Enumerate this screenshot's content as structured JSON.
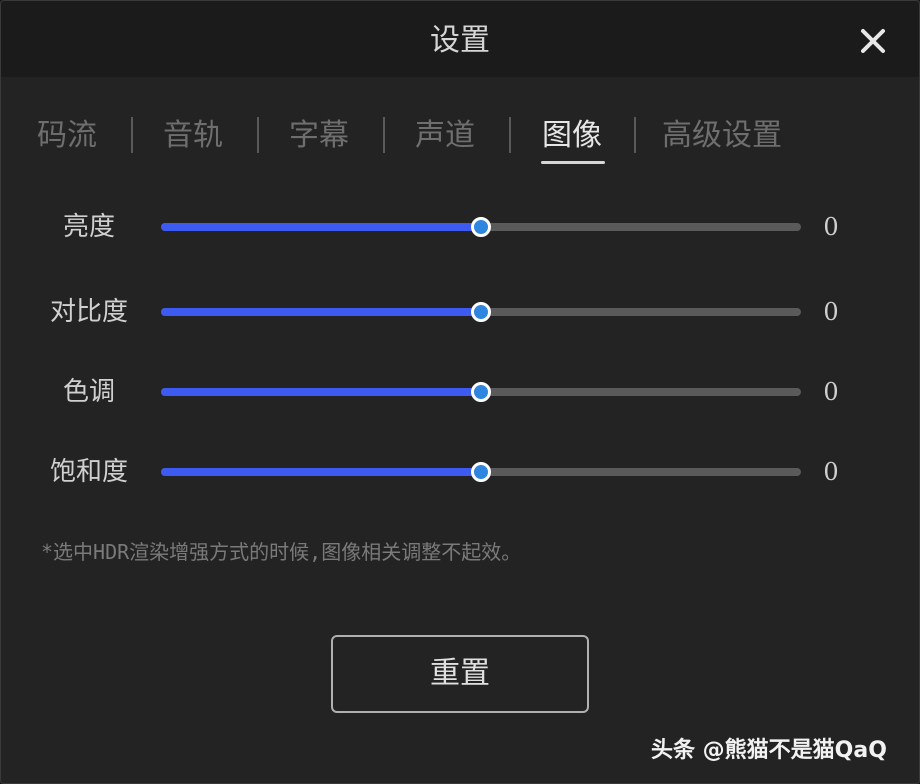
{
  "dialog": {
    "title": "设置",
    "close_icon": "close-icon"
  },
  "tabs": [
    {
      "label": "码流",
      "active": false
    },
    {
      "label": "音轨",
      "active": false
    },
    {
      "label": "字幕",
      "active": false
    },
    {
      "label": "声道",
      "active": false
    },
    {
      "label": "图像",
      "active": true
    },
    {
      "label": "高级设置",
      "active": false
    }
  ],
  "sliders": [
    {
      "label": "亮度",
      "value": "0",
      "level": 0.5
    },
    {
      "label": "对比度",
      "value": "0",
      "level": 0.5
    },
    {
      "label": "色调",
      "value": "0",
      "level": 0.5
    },
    {
      "label": "饱和度",
      "value": "0",
      "level": 0.5
    }
  ],
  "note": "*选中HDR渲染增强方式的时候,图像相关调整不起效。",
  "reset_label": "重置",
  "watermark": "头条 @熊猫不是猫QaQ",
  "colors": {
    "accent_fill": "#3d5af1",
    "thumb": "#2e86de",
    "track": "#5a5a5a",
    "background": "#232323"
  }
}
